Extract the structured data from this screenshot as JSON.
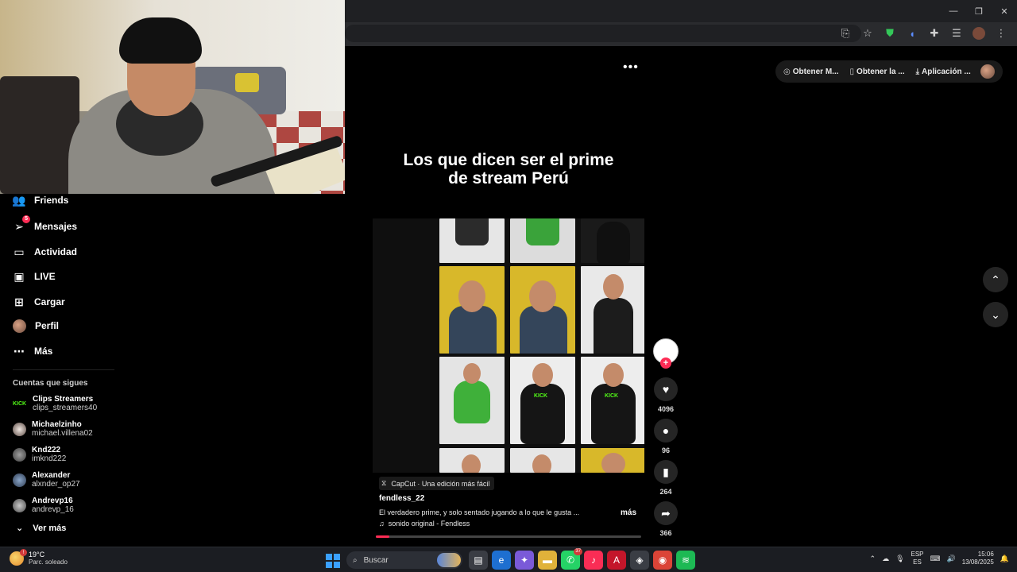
{
  "sidebar": {
    "items": [
      {
        "label": "Friends",
        "icon": "friends-icon"
      },
      {
        "label": "Mensajes",
        "icon": "messages-icon",
        "badge": "5"
      },
      {
        "label": "Actividad",
        "icon": "activity-icon"
      },
      {
        "label": "LIVE",
        "icon": "live-icon"
      },
      {
        "label": "Cargar",
        "icon": "upload-icon"
      },
      {
        "label": "Perfil",
        "icon": "profile-avatar"
      },
      {
        "label": "Más",
        "icon": "more-icon"
      }
    ],
    "following_title": "Cuentas que sigues",
    "following": [
      {
        "name": "Clips Streamers",
        "user": "clips_streamers40"
      },
      {
        "name": "Michaelzinho",
        "user": "michael.villena02"
      },
      {
        "name": "Knd222",
        "user": "imknd222"
      },
      {
        "name": "Alexander",
        "user": "alxnder_op27"
      },
      {
        "name": "Andrevp16",
        "user": "andrevp_16"
      }
    ],
    "see_more": "Ver más"
  },
  "top_actions": {
    "item1": "Obtener M...",
    "item2": "Obtener la ...",
    "item3": "Aplicación ..."
  },
  "video": {
    "title_line1": "Los que dicen ser el prime",
    "title_line2": "de stream Perú",
    "progress": 0.05,
    "capcut": "CapCut · Una edición más fácil",
    "author": "fendless_22",
    "description": "El verdadero prime, y solo sentado jugando a lo que le gusta ...",
    "more": "más",
    "sound": "sonido original - Fendless",
    "kick_text": "KICK"
  },
  "actions": {
    "likes": "4096",
    "comments": "96",
    "saves": "264",
    "shares": "366"
  },
  "taskbar": {
    "temp": "19°C",
    "weather": "Parc. soleado",
    "search_placeholder": "Buscar",
    "whatsapp_badge": "37",
    "lang1": "ESP",
    "lang2": "ES",
    "time": "15:06",
    "date": "13/08/2025"
  },
  "colors": {
    "accent": "#fe2c55",
    "kick_green": "#53fc18"
  }
}
